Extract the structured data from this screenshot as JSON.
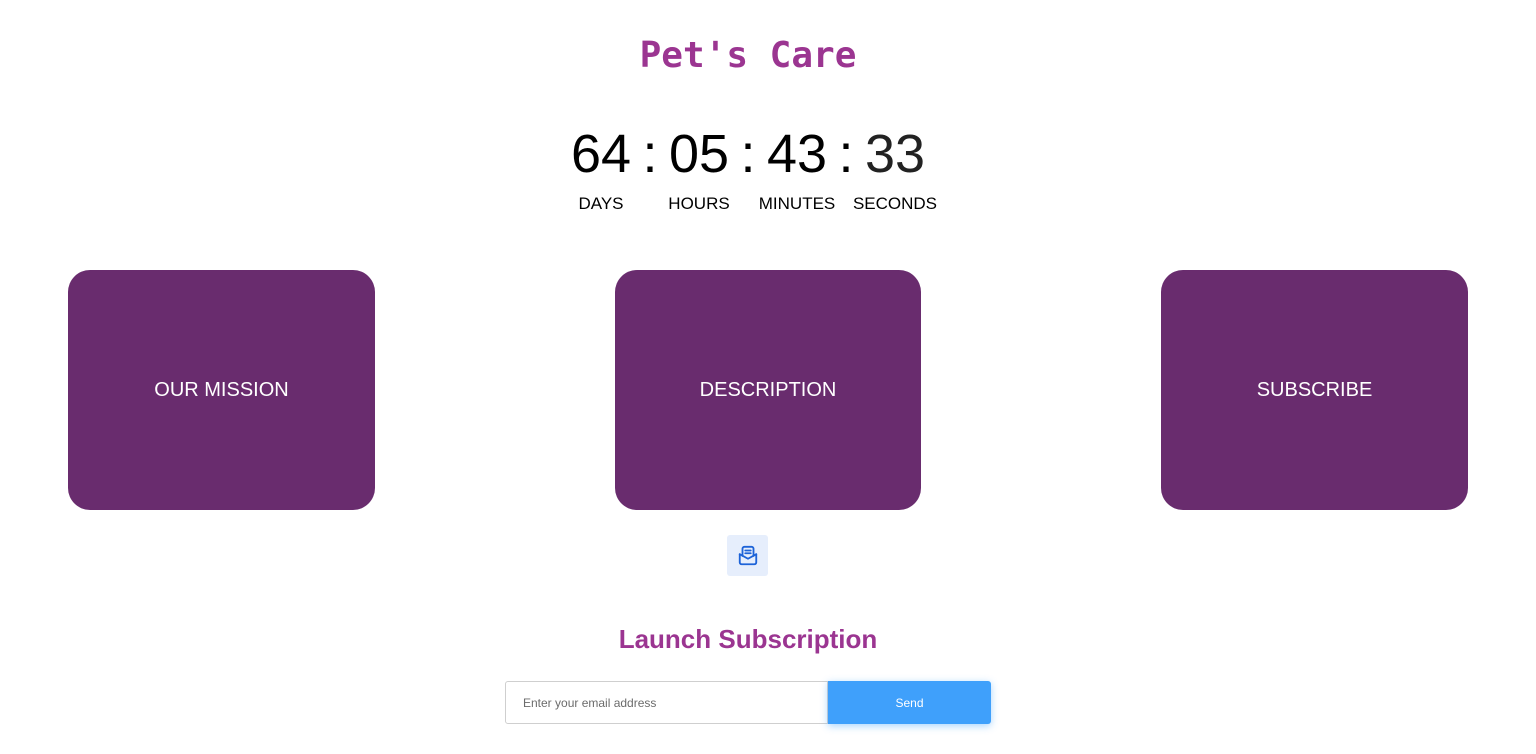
{
  "header": {
    "title": "Pet's Care"
  },
  "countdown": {
    "days": "64",
    "hours": "05",
    "minutes": "43",
    "seconds": "33",
    "separator": ":",
    "labels": {
      "days": "DAYS",
      "hours": "HOURS",
      "minutes": "MINUTES",
      "seconds": "SECONDS"
    }
  },
  "cards": [
    {
      "label": "OUR MISSION"
    },
    {
      "label": "DESCRIPTION"
    },
    {
      "label": "SUBSCRIBE"
    }
  ],
  "subscribe": {
    "icon": "mail-open-icon",
    "title": "Launch Subscription",
    "email_placeholder": "Enter your email address",
    "send_label": "Send"
  },
  "colors": {
    "accent_purple": "#9b3591",
    "card_purple": "#692c6e",
    "send_blue": "#3fa0fb",
    "icon_blue": "#1d63d8"
  }
}
